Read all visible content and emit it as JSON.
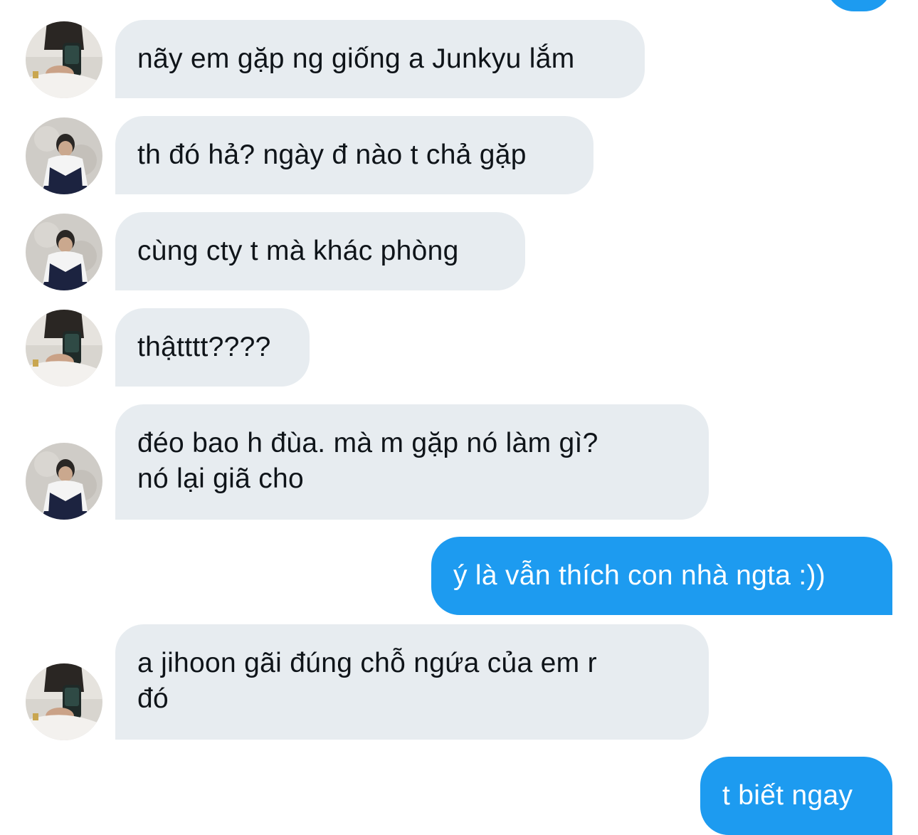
{
  "conversation": {
    "messages": [
      {
        "sender": "other",
        "avatar": "mirror-selfie-avatar",
        "text": "nãy em gặp ng giống a Junkyu lắm"
      },
      {
        "sender": "other",
        "avatar": "sitting-pose-avatar",
        "text": "th đó hả? ngày đ nào t chả gặp"
      },
      {
        "sender": "other",
        "avatar": "sitting-pose-avatar",
        "text": "cùng cty t mà khác phòng"
      },
      {
        "sender": "other",
        "avatar": "mirror-selfie-avatar",
        "text": "thậtttt????"
      },
      {
        "sender": "other",
        "avatar": "sitting-pose-avatar",
        "lines": [
          "đéo bao h đùa. mà m gặp nó làm gì?",
          "nó lại giã cho"
        ]
      },
      {
        "sender": "me",
        "text": "ý là vẫn thích con nhà ngta :))"
      },
      {
        "sender": "other",
        "avatar": "mirror-selfie-avatar",
        "lines": [
          "a jihoon gãi đúng chỗ ngứa của em r",
          "đó"
        ]
      },
      {
        "sender": "me",
        "text": "t biết ngay"
      }
    ]
  },
  "colors": {
    "incoming_bubble": "#e7ecf0",
    "incoming_text": "#0f1419",
    "outgoing_bubble": "#1d9bf0",
    "outgoing_text": "#ffffff",
    "background": "#ffffff"
  }
}
